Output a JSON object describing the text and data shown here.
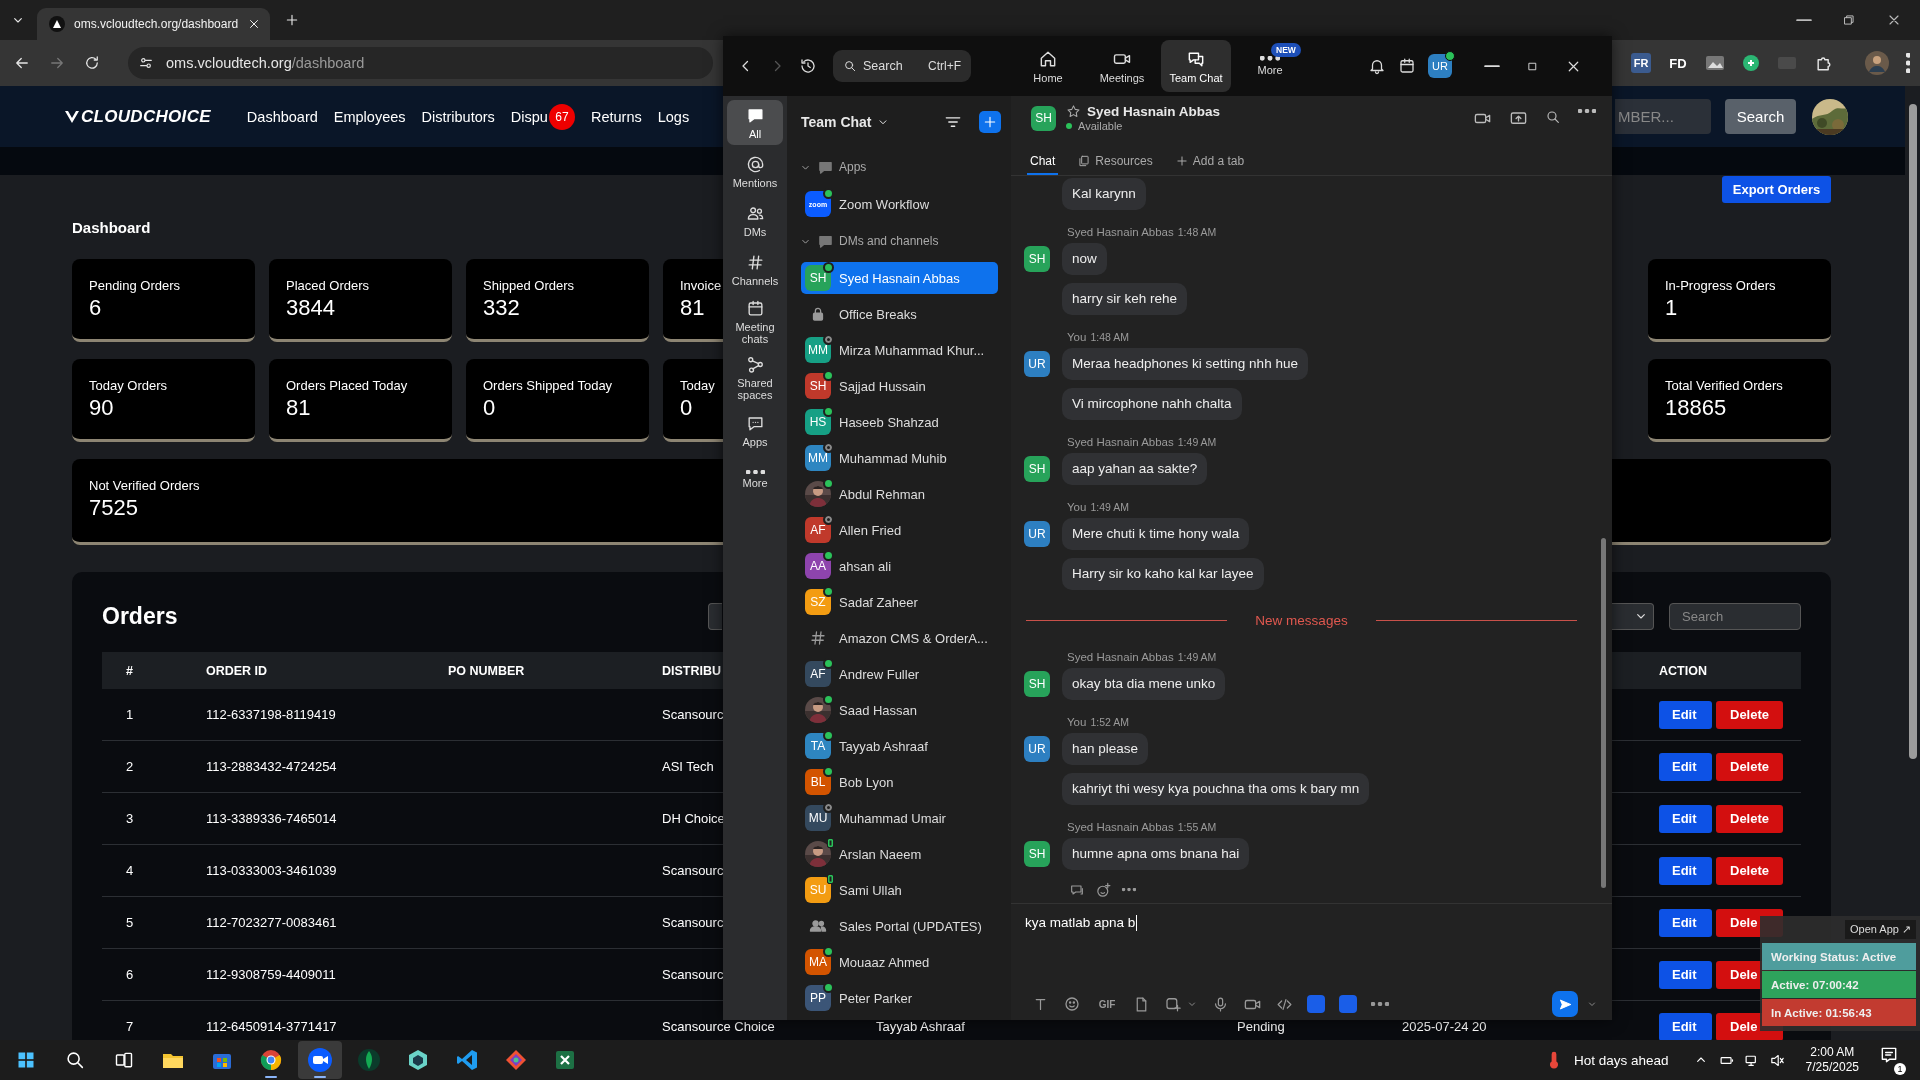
{
  "browser": {
    "tab_title": "oms.vcloudtech.org/dashboard",
    "url_host": "oms.vcloudtech.org",
    "url_path": "/dashboard",
    "extensions": [
      {
        "label": "FR"
      },
      {
        "label": "FD"
      }
    ]
  },
  "site": {
    "logo": "CLOUDCHOICE",
    "nav": [
      {
        "label": "Dashboard"
      },
      {
        "label": "Employees"
      },
      {
        "label": "Distributors"
      },
      {
        "label": "Dispu",
        "badge": "67"
      },
      {
        "label": "Returns"
      },
      {
        "label": "Logs"
      }
    ],
    "search_placeholder": "MBER...",
    "search_button": "Search"
  },
  "dashboard": {
    "title": "Dashboard",
    "export_button": "Export Orders",
    "card_rows": [
      [
        {
          "label": "Pending Orders",
          "value": "6"
        },
        {
          "label": "Placed Orders",
          "value": "3844"
        },
        {
          "label": "Shipped Orders",
          "value": "332"
        },
        {
          "label": "Invoice",
          "value": "81"
        },
        {
          "label": "In-Progress Orders",
          "value": "1"
        }
      ],
      [
        {
          "label": "Today Orders",
          "value": "90"
        },
        {
          "label": "Orders Placed Today",
          "value": "81"
        },
        {
          "label": "Orders Shipped Today",
          "value": "0"
        },
        {
          "label": "Today",
          "value": "0"
        },
        {
          "label": "Total Verified Orders",
          "value": "18865"
        }
      ]
    ],
    "wide_card": {
      "label": "Not Verified Orders",
      "value": "7525"
    }
  },
  "orders": {
    "title": "Orders",
    "search_placeholder": "Search",
    "columns": [
      "#",
      "ORDER ID",
      "PO NUMBER",
      "DISTRIBU",
      "ACTION"
    ],
    "rows": [
      {
        "number": "1",
        "order_id": "112-6337198-8119419",
        "distributor": "Scansourc",
        "edit": "Edit",
        "delete": "Delete"
      },
      {
        "number": "2",
        "order_id": "113-2883432-4724254",
        "distributor": "ASI Tech",
        "edit": "Edit",
        "delete": "Delete"
      },
      {
        "number": "3",
        "order_id": "113-3389336-7465014",
        "distributor": "DH Choice",
        "edit": "Edit",
        "delete": "Delete"
      },
      {
        "number": "4",
        "order_id": "113-0333003-3461039",
        "distributor": "Scansourc",
        "edit": "Edit",
        "delete": "Delete"
      },
      {
        "number": "5",
        "order_id": "112-7023277-0083461",
        "distributor": "Scansourc",
        "edit": "Edit",
        "delete": "Dele"
      },
      {
        "number": "6",
        "order_id": "112-9308759-4409011",
        "distributor": "Scansourc",
        "edit": "Edit",
        "delete": "Dele"
      },
      {
        "number": "7",
        "order_id": "112-6450914-3771417",
        "distributor": "Scansource Choice",
        "column_5": "Tayyab Ashraaf",
        "column_6": "Pending",
        "column_7": "2025-07-24 20",
        "edit": "Edit",
        "delete": "Dele"
      }
    ]
  },
  "zoom": {
    "search": {
      "placeholder": "Search",
      "shortcut": "Ctrl+F"
    },
    "nav_tabs": [
      {
        "label": "Home",
        "kind": "home",
        "selected": false
      },
      {
        "label": "Meetings",
        "kind": "meetings",
        "selected": false
      },
      {
        "label": "Team Chat",
        "kind": "chat",
        "selected": true
      },
      {
        "label": "More",
        "kind": "more",
        "selected": false,
        "badge": "NEW"
      }
    ],
    "user_initials": "UR",
    "rail": [
      {
        "label": "All",
        "kind": "all",
        "selected": true
      },
      {
        "label": "Mentions",
        "kind": "mentions",
        "selected": false
      },
      {
        "label": "DMs",
        "kind": "dms",
        "selected": false
      },
      {
        "label": "Channels",
        "kind": "channels",
        "selected": false
      },
      {
        "label": "Meeting chats",
        "kind": "meetings",
        "selected": false
      },
      {
        "label": "Shared spaces",
        "kind": "spaces",
        "selected": false
      },
      {
        "label": "Apps",
        "kind": "apps",
        "selected": false
      },
      {
        "label": "More",
        "kind": "more",
        "selected": false
      }
    ],
    "list_title": "Team Chat",
    "sections": [
      {
        "title": "Apps",
        "expanded": true,
        "items": [
          {
            "name": "Zoom Workflow",
            "avatar": {
              "kind": "app",
              "initials": "zoom",
              "color": "#0b5cff"
            },
            "status": {
              "kind": "dot",
              "color": "#2bc25a"
            },
            "selected": false
          }
        ]
      },
      {
        "title": "DMs and channels",
        "expanded": true,
        "items": [
          {
            "name": "Syed Hasnain Abbas",
            "avatar": {
              "kind": "initials",
              "initials": "SH",
              "color": "#27a35a"
            },
            "status": {
              "kind": "dot",
              "color": "#2bc25a"
            },
            "selected": true
          },
          {
            "name": "Office Breaks",
            "avatar": {
              "kind": "lock"
            },
            "selected": false
          },
          {
            "name": "Mirza Muhammad Khur...",
            "avatar": {
              "kind": "initials",
              "initials": "MM",
              "color": "#17a085"
            },
            "status": {
              "kind": "ring",
              "color": "#8a8a8a"
            },
            "selected": false
          },
          {
            "name": "Sajjad Hussain",
            "avatar": {
              "kind": "initials",
              "initials": "SH",
              "color": "#c0392b"
            },
            "status": {
              "kind": "dot",
              "color": "#2bc25a"
            },
            "selected": false
          },
          {
            "name": "Haseeb Shahzad",
            "avatar": {
              "kind": "initials",
              "initials": "HS",
              "color": "#16a085"
            },
            "status": {
              "kind": "dot",
              "color": "#2bc25a"
            },
            "selected": false
          },
          {
            "name": "Muhammad Muhib",
            "avatar": {
              "kind": "initials",
              "initials": "MM",
              "color": "#2e86c1"
            },
            "status": {
              "kind": "ring",
              "color": "#8a8a8a"
            },
            "selected": false
          },
          {
            "name": "Abdul Rehman",
            "status": {
              "kind": "dot",
              "color": "#2bc25a"
            },
            "selected": false
          },
          {
            "name": "Allen Fried",
            "avatar": {
              "kind": "initials",
              "initials": "AF",
              "color": "#c0392b"
            },
            "status": {
              "kind": "ring",
              "color": "#8a8a8a"
            },
            "selected": false
          },
          {
            "name": "ahsan ali",
            "avatar": {
              "kind": "initials",
              "initials": "AA",
              "color": "#8e44ad"
            },
            "status": {
              "kind": "dot",
              "color": "#2bc25a"
            },
            "selected": false
          },
          {
            "name": "Sadaf Zaheer",
            "avatar": {
              "kind": "initials",
              "initials": "SZ",
              "color": "#f39c12"
            },
            "status": {
              "kind": "dot",
              "color": "#2bc25a"
            },
            "selected": false
          },
          {
            "name": "Amazon CMS & OrderA...",
            "avatar": {
              "kind": "hash"
            },
            "selected": false
          },
          {
            "name": "Andrew Fuller",
            "avatar": {
              "kind": "initials",
              "initials": "AF",
              "color": "#34495e"
            },
            "status": {
              "kind": "dot",
              "color": "#2bc25a"
            },
            "selected": false
          },
          {
            "name": "Saad Hassan",
            "status": {
              "kind": "dot",
              "color": "#2bc25a"
            },
            "selected": false
          },
          {
            "name": "Tayyab Ashraaf",
            "avatar": {
              "kind": "initials",
              "initials": "TA",
              "color": "#2e86c1"
            },
            "status": {
              "kind": "dot",
              "color": "#2bc25a"
            },
            "selected": false
          },
          {
            "name": "Bob Lyon",
            "avatar": {
              "kind": "initials",
              "initials": "BL",
              "color": "#d35400"
            },
            "status": {
              "kind": "dot",
              "color": "#2bc25a"
            },
            "selected": false
          },
          {
            "name": "Muhammad Umair",
            "avatar": {
              "kind": "initials",
              "initials": "MU",
              "color": "#34495e"
            },
            "status": {
              "kind": "ring",
              "color": "#8a8a8a"
            },
            "selected": false
          },
          {
            "name": "Arslan Naeem",
            "status": {
              "kind": "phone",
              "color": "#2bc25a"
            },
            "selected": false
          },
          {
            "name": "Sami Ullah",
            "avatar": {
              "kind": "initials",
              "initials": "SU",
              "color": "#f39c12"
            },
            "status": {
              "kind": "phone",
              "color": "#2bc25a"
            },
            "selected": false
          },
          {
            "name": "Sales Portal (UPDATES)",
            "avatar": {
              "kind": "group"
            },
            "selected": false
          },
          {
            "name": "Mouaaz Ahmed",
            "avatar": {
              "kind": "initials",
              "initials": "MA",
              "color": "#d35400"
            },
            "status": {
              "kind": "dot",
              "color": "#2bc25a"
            },
            "selected": false
          },
          {
            "name": "Peter Parker",
            "avatar": {
              "kind": "initials",
              "initials": "PP",
              "color": "#3b5577"
            },
            "status": {
              "kind": "dot",
              "color": "#2bc25a"
            },
            "selected": false
          }
        ]
      }
    ],
    "chat": {
      "initials": "SH",
      "color": "#27a35a",
      "name": "Syed Hasnain Abbas",
      "status": "Available",
      "status_dot": {
        "color": "#2bc25a"
      },
      "tabs": [
        {
          "label": "Chat",
          "kind": "chat",
          "selected": true
        },
        {
          "label": "Resources",
          "kind": "resources",
          "selected": false
        },
        {
          "label": "Add a tab",
          "kind": "add",
          "selected": false
        }
      ],
      "messages": [
        {
          "kind": "group",
          "bubbles": [
            "Kal karynn"
          ]
        },
        {
          "kind": "group",
          "sender": "Syed Hasnain Abbas",
          "time": "1:48 AM",
          "initials": "SH",
          "color": "#27a35a",
          "bubbles": [
            "now",
            "harry sir keh rehe"
          ]
        },
        {
          "kind": "group",
          "sender": "You",
          "time": "1:48 AM",
          "initials": "UR",
          "color": "#2d7fc1",
          "bubbles": [
            "Meraa headphones ki setting nhh hue",
            "Vi mircophone nahh chalta"
          ]
        },
        {
          "kind": "group",
          "sender": "Syed Hasnain Abbas",
          "time": "1:49 AM",
          "initials": "SH",
          "color": "#27a35a",
          "bubbles": [
            "aap yahan aa sakte?"
          ]
        },
        {
          "kind": "group",
          "sender": "You",
          "time": "1:49 AM",
          "initials": "UR",
          "color": "#2d7fc1",
          "bubbles": [
            "Mere chuti k time hony wala",
            "Harry sir ko kaho kal kar layee"
          ]
        },
        {
          "kind": "divider",
          "label": "New messages"
        },
        {
          "kind": "group",
          "sender": "Syed Hasnain Abbas",
          "time": "1:49 AM",
          "initials": "SH",
          "color": "#27a35a",
          "bubbles": [
            "okay bta dia mene unko"
          ]
        },
        {
          "kind": "group",
          "sender": "You",
          "time": "1:52 AM",
          "initials": "UR",
          "color": "#2d7fc1",
          "bubbles": [
            "han please",
            "kahriyt thi wesy kya pouchna tha oms k bary mn"
          ]
        },
        {
          "kind": "group",
          "sender": "Syed Hasnain Abbas",
          "time": "1:55 AM",
          "initials": "SH",
          "color": "#27a35a",
          "bubbles": [
            "humne apna oms bnana hai"
          ]
        }
      ],
      "composer_value": "kya matlab apna b",
      "gif_label": "GIF"
    }
  },
  "status_widget": {
    "open_app": "Open App ↗",
    "rows": [
      {
        "label": "Working Status: Active",
        "color": "#4f9d9d"
      },
      {
        "label": "Active: 07:00:42",
        "color": "#2ea35c"
      },
      {
        "label": "In Active: 01:56:43",
        "color": "#c23b30"
      }
    ]
  },
  "taskbar": {
    "apps": [
      {
        "kind": "explorer",
        "open": false,
        "selected": false
      },
      {
        "kind": "store",
        "open": false,
        "selected": false
      },
      {
        "kind": "chrome",
        "open": true,
        "selected": false
      },
      {
        "kind": "zoom",
        "open": true,
        "selected": true
      },
      {
        "kind": "leaf",
        "open": false,
        "selected": false
      },
      {
        "kind": "hex",
        "open": false,
        "selected": false
      },
      {
        "kind": "vscode",
        "open": false,
        "selected": false
      },
      {
        "kind": "git",
        "open": false,
        "selected": false
      },
      {
        "kind": "excel",
        "open": false,
        "selected": false
      }
    ],
    "weather": "Hot days ahead",
    "time": "2:00 AM",
    "date": "7/25/2025",
    "notifications": "1"
  }
}
